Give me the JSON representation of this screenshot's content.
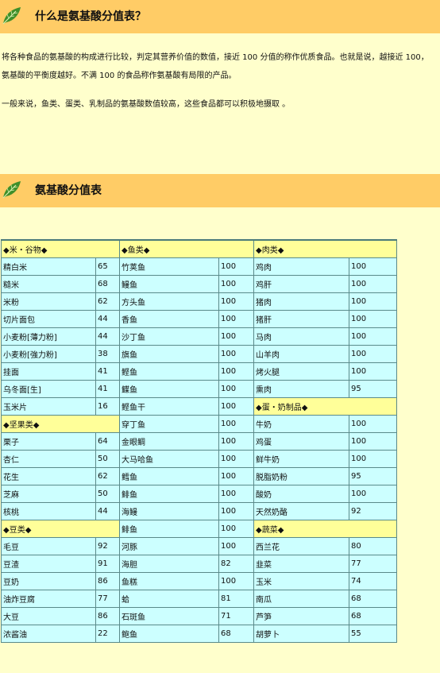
{
  "section1": {
    "title": "什么是氨基酸分值表？",
    "paragraphs": [
      "将各种食品的氨基酸的构成进行比较，判定其营养价值的数值，接近 100 分值的称作优质食品。也就是说，越接近 100，氨基酸的平衡度越好。不满 100 的食品称作氨基酸有局限的产品。",
      "一般来说，鱼类、蛋类、乳制品的氨基酸数值较高，这些食品都可以积极地摄取 。"
    ]
  },
  "section2": {
    "title": "氨基酸分值表"
  },
  "table": {
    "rows": [
      {
        "cells": [
          {
            "t": "◆米・谷物◆",
            "cat": true
          },
          {
            "t": "◆鱼类◆",
            "cat": true
          },
          {
            "t": "◆肉类◆",
            "cat": true
          }
        ]
      },
      {
        "cells": [
          {
            "n": "精白米",
            "v": "65"
          },
          {
            "n": "竹荚鱼",
            "v": "100"
          },
          {
            "n": "鸡肉",
            "v": "100"
          }
        ]
      },
      {
        "cells": [
          {
            "n": "糙米",
            "v": "68"
          },
          {
            "n": "鳗鱼",
            "v": "100"
          },
          {
            "n": "鸡肝",
            "v": "100"
          }
        ]
      },
      {
        "cells": [
          {
            "n": "米粉",
            "v": "62"
          },
          {
            "n": "方头鱼",
            "v": "100"
          },
          {
            "n": "猪肉",
            "v": "100"
          }
        ]
      },
      {
        "cells": [
          {
            "n": "切片面包",
            "v": "44"
          },
          {
            "n": "香鱼",
            "v": "100"
          },
          {
            "n": "猪肝",
            "v": "100"
          }
        ]
      },
      {
        "cells": [
          {
            "n": "小麦粉[薄力粉]",
            "v": "44"
          },
          {
            "n": "沙丁鱼",
            "v": "100"
          },
          {
            "n": "马肉",
            "v": "100"
          }
        ]
      },
      {
        "cells": [
          {
            "n": "小麦粉[強力粉]",
            "v": "38"
          },
          {
            "n": "旗鱼",
            "v": "100"
          },
          {
            "n": "山羊肉",
            "v": "100"
          }
        ]
      },
      {
        "cells": [
          {
            "n": "挂面",
            "v": "41"
          },
          {
            "n": "鲣鱼",
            "v": "100"
          },
          {
            "n": "烤火腿",
            "v": "100"
          }
        ]
      },
      {
        "cells": [
          {
            "n": "乌冬面[生]",
            "v": "41"
          },
          {
            "n": "鲽鱼",
            "v": "100"
          },
          {
            "n": "熏肉",
            "v": "95"
          }
        ]
      },
      {
        "cells": [
          {
            "n": "玉米片",
            "v": "16"
          },
          {
            "n": "鲣鱼干",
            "v": "100"
          },
          {
            "t": "◆蛋・奶制品◆",
            "cat": true
          }
        ]
      },
      {
        "cells": [
          {
            "t": "◆坚果类◆",
            "cat": true
          },
          {
            "n": "穿丁鱼",
            "v": "100"
          },
          {
            "n": "牛奶",
            "v": "100"
          }
        ]
      },
      {
        "cells": [
          {
            "n": "栗子",
            "v": "64"
          },
          {
            "n": "金眼鲷",
            "v": "100"
          },
          {
            "n": "鸡蛋",
            "v": "100"
          }
        ]
      },
      {
        "cells": [
          {
            "n": "杏仁",
            "v": "50"
          },
          {
            "n": "大马哈鱼",
            "v": "100"
          },
          {
            "n": "鲜牛奶",
            "v": "100"
          }
        ]
      },
      {
        "cells": [
          {
            "n": "花生",
            "v": "62"
          },
          {
            "n": "鳕鱼",
            "v": "100"
          },
          {
            "n": "脱脂奶粉",
            "v": "95"
          }
        ]
      },
      {
        "cells": [
          {
            "n": "芝麻",
            "v": "50"
          },
          {
            "n": "鲱鱼",
            "v": "100"
          },
          {
            "n": "酸奶",
            "v": "100"
          }
        ]
      },
      {
        "cells": [
          {
            "n": "核桃",
            "v": "44"
          },
          {
            "n": "海鳗",
            "v": "100"
          },
          {
            "n": "天然奶酪",
            "v": "92"
          }
        ]
      },
      {
        "cells": [
          {
            "t": "◆豆类◆",
            "cat": true
          },
          {
            "n": "鲱鱼",
            "v": "100"
          },
          {
            "t": "◆蔬菜◆",
            "cat": true
          }
        ]
      },
      {
        "cells": [
          {
            "n": "毛豆",
            "v": "92"
          },
          {
            "n": "河豚",
            "v": "100"
          },
          {
            "n": "西兰花",
            "v": "80"
          }
        ]
      },
      {
        "cells": [
          {
            "n": "豆渣",
            "v": "91"
          },
          {
            "n": "海胆",
            "v": "82"
          },
          {
            "n": "韭菜",
            "v": "77"
          }
        ]
      },
      {
        "cells": [
          {
            "n": "豆奶",
            "v": "86"
          },
          {
            "n": "鱼糕",
            "v": "100"
          },
          {
            "n": "玉米",
            "v": "74"
          }
        ]
      },
      {
        "cells": [
          {
            "n": "油炸豆腐",
            "v": "77"
          },
          {
            "n": "蛤",
            "v": "81"
          },
          {
            "n": "南瓜",
            "v": "68"
          }
        ]
      },
      {
        "cells": [
          {
            "n": "大豆",
            "v": "86"
          },
          {
            "n": "石斑鱼",
            "v": "71"
          },
          {
            "n": "芦笋",
            "v": "68"
          }
        ]
      },
      {
        "cells": [
          {
            "n": "浓酱油",
            "v": "22"
          },
          {
            "n": "鲍鱼",
            "v": "68"
          },
          {
            "n": "胡萝卜",
            "v": "55"
          }
        ]
      }
    ]
  }
}
